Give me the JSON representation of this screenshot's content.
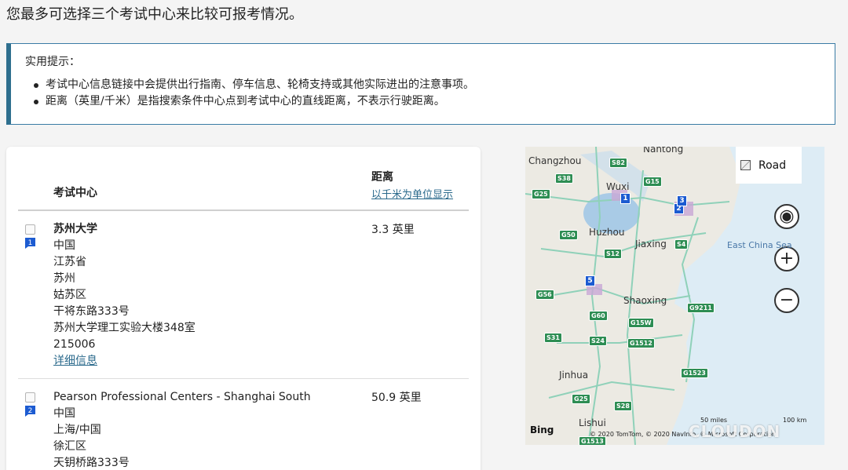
{
  "intro": "您最多可选择三个考试中心来比较可报考情况。",
  "tips": {
    "title": "实用提示：",
    "items": [
      "考试中心信息链接中会提供出行指南、停车信息、轮椅支持或其他实际进出的注意事项。",
      "距离（英里/千米）是指搜索条件中心点到考试中心的直线距离，不表示行驶距离。"
    ]
  },
  "table": {
    "col_center": "考试中心",
    "col_distance": "距离",
    "toggle_units": "以千米为单位显示"
  },
  "results": [
    {
      "pin": "1",
      "name": "苏州大学",
      "lines": [
        "中国",
        "江苏省",
        "苏州",
        "姑苏区",
        "干将东路333号",
        "苏州大学理工实验大楼348室",
        "215006"
      ],
      "details": "详细信息",
      "distance": "3.3  英里"
    },
    {
      "pin": "2",
      "name": "Pearson Professional Centers - Shanghai South",
      "lines": [
        "中国",
        "上海/中国",
        "徐汇区",
        "天钥桥路333号"
      ],
      "distance": "50.9  英里"
    }
  ],
  "map": {
    "road_label": "Road",
    "cities": [
      "Nantong",
      "Changzhou",
      "Wuxi",
      "Huzhou",
      "Jiaxing",
      "Shaoxing",
      "Jinhua",
      "Lishui"
    ],
    "sea": "East China Sea",
    "highways": [
      "S82",
      "S38",
      "G15",
      "G25",
      "G50",
      "S12",
      "S4",
      "G56",
      "G60",
      "G15W",
      "G9211",
      "S31",
      "S24",
      "G1512",
      "G1523",
      "G25",
      "S28",
      "G1513"
    ],
    "pins": [
      "1",
      "2",
      "3",
      "5"
    ],
    "bing": "Bing",
    "scale_miles": "50 miles",
    "scale_km": "100 km",
    "copyright": "© 2020 TomTom, © 2020 NavInfo, © Microsoft Corporation",
    "zoom_in": "+",
    "zoom_out": "−",
    "locate": "◉"
  },
  "watermark": "CLOUDON",
  "colors": {
    "accent": "#2e6f8e",
    "link": "#2b6a8c",
    "pin": "#1c5bd1",
    "highway": "#2d8d53"
  }
}
